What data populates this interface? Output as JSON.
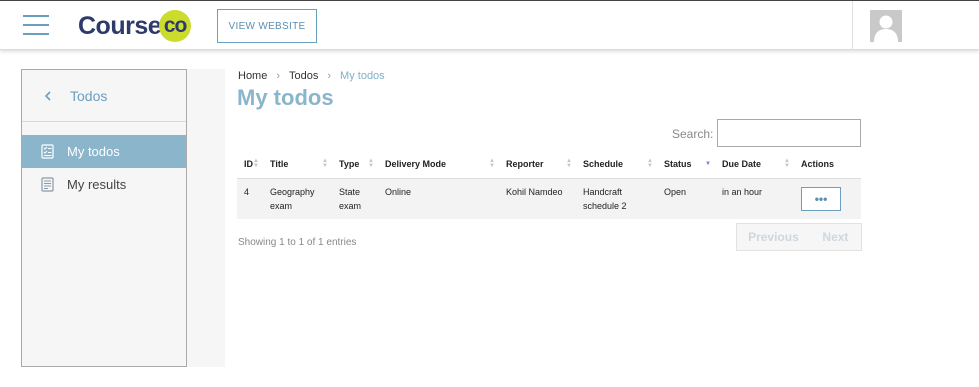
{
  "header": {
    "logo_text": "Course",
    "logo_suffix": "co",
    "view_website_label": "VIEW WEBSITE",
    "brand_colors": {
      "accent": "#6a9fbf",
      "logo_dark": "#2e3a6b",
      "logo_lime": "#cbdc2c"
    }
  },
  "sidebar": {
    "back_label": "Todos",
    "items": [
      {
        "label": "My todos",
        "icon": "todo-list-icon",
        "active": true
      },
      {
        "label": "My results",
        "icon": "results-icon",
        "active": false
      }
    ]
  },
  "breadcrumb": {
    "items": [
      "Home",
      "Todos",
      "My todos"
    ]
  },
  "page": {
    "title": "My todos"
  },
  "search": {
    "label": "Search:",
    "value": ""
  },
  "table": {
    "columns": [
      "ID",
      "Title",
      "Type",
      "Delivery Mode",
      "Reporter",
      "Schedule",
      "Status",
      "Due Date",
      "Actions"
    ],
    "rows": [
      {
        "id": "4",
        "title": "Geography exam",
        "type": "State exam",
        "delivery_mode": "Online",
        "reporter": "Kohil Namdeo",
        "schedule": "Handcraft schedule 2",
        "status": "Open",
        "due_date": "in an hour",
        "action_label": "•••"
      }
    ]
  },
  "footer": {
    "showing_text": "Showing 1 to 1 of 1 entries",
    "previous_label": "Previous",
    "next_label": "Next"
  }
}
